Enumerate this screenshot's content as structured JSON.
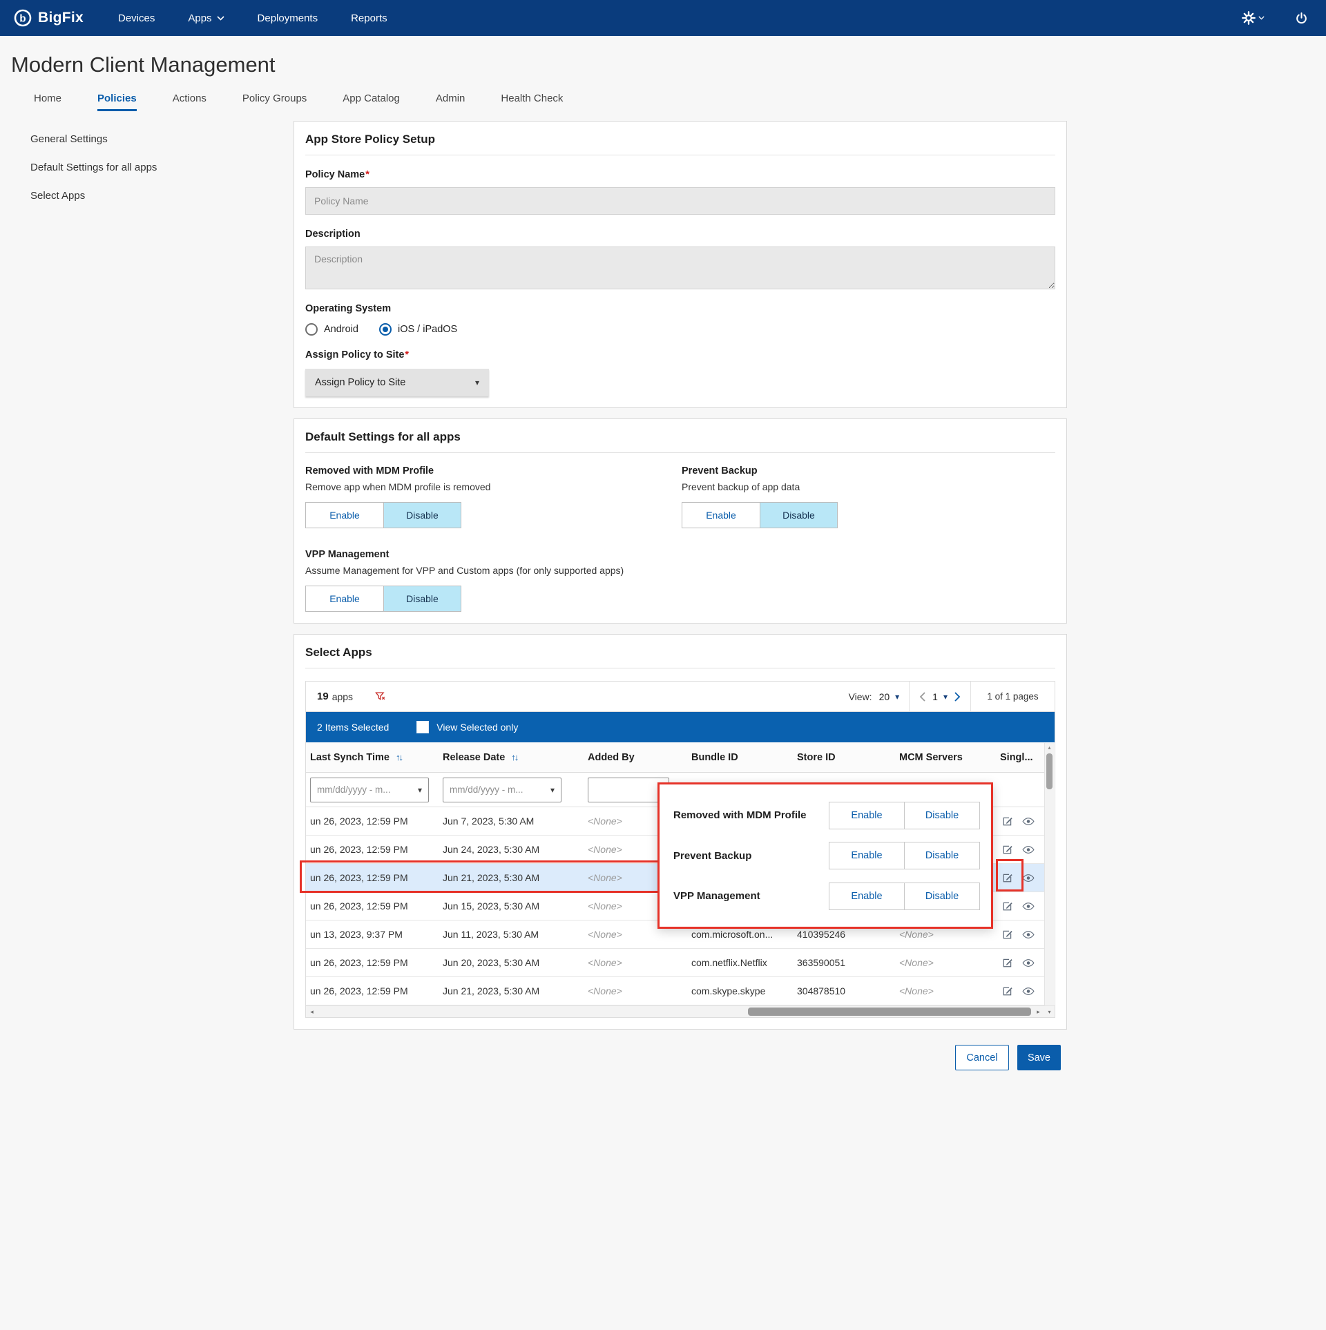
{
  "topnav": {
    "brand": "BigFix",
    "items": [
      {
        "label": "Devices"
      },
      {
        "label": "Apps"
      },
      {
        "label": "Deployments"
      },
      {
        "label": "Reports"
      }
    ]
  },
  "page": {
    "title": "Modern Client Management"
  },
  "tabs": [
    {
      "label": "Home"
    },
    {
      "label": "Policies"
    },
    {
      "label": "Actions"
    },
    {
      "label": "Policy Groups"
    },
    {
      "label": "App Catalog"
    },
    {
      "label": "Admin"
    },
    {
      "label": "Health Check"
    }
  ],
  "sidebar": [
    {
      "label": "General Settings"
    },
    {
      "label": "Default Settings for all apps"
    },
    {
      "label": "Select Apps"
    }
  ],
  "policy_setup": {
    "title": "App Store Policy Setup",
    "policy_name_label": "Policy Name",
    "required_mark": "*",
    "policy_name_placeholder": "Policy Name",
    "description_label": "Description",
    "description_placeholder": "Description",
    "os_label": "Operating System",
    "os_android": "Android",
    "os_ios": "iOS / iPadOS",
    "assign_label": "Assign Policy to Site",
    "assign_value": "Assign Policy to Site"
  },
  "default_settings": {
    "title": "Default Settings for all apps",
    "enable_label": "Enable",
    "disable_label": "Disable",
    "groups": [
      {
        "name": "Removed with MDM Profile",
        "desc": "Remove app when MDM profile is removed"
      },
      {
        "name": "Prevent Backup",
        "desc": "Prevent backup of app data"
      },
      {
        "name": "VPP Management",
        "desc": "Assume Management for VPP and Custom apps (for only supported apps)"
      }
    ]
  },
  "select_apps": {
    "title": "Select Apps",
    "count": "19",
    "count_label": "apps",
    "view_label": "View:",
    "view_value": "20",
    "page_value": "1",
    "pages_text": "1 of 1 pages",
    "selected_text": "2 Items Selected",
    "view_selected_label": "View Selected only",
    "columns": [
      "Last Synch Time",
      "Release Date",
      "Added By",
      "Bundle ID",
      "Store ID",
      "MCM Servers",
      "Singl..."
    ],
    "date_filter_placeholder": "mm/dd/yyyy - m...",
    "rows": [
      {
        "synch": "un 26, 2023, 12:59 PM",
        "release": "Jun 7, 2023, 5:30 AM",
        "added_by": "<None>",
        "bundle_id": "",
        "store_id": "",
        "mcm": ""
      },
      {
        "synch": "un 26, 2023, 12:59 PM",
        "release": "Jun 24, 2023, 5:30 AM",
        "added_by": "<None>",
        "bundle_id": "",
        "store_id": "",
        "mcm": ""
      },
      {
        "synch": "un 26, 2023, 12:59 PM",
        "release": "Jun 21, 2023, 5:30 AM",
        "added_by": "<None>",
        "bundle_id": "",
        "store_id": "",
        "mcm": ""
      },
      {
        "synch": "un 26, 2023, 12:59 PM",
        "release": "Jun 15, 2023, 5:30 AM",
        "added_by": "<None>",
        "bundle_id": "",
        "store_id": "",
        "mcm": ""
      },
      {
        "synch": "un 13, 2023, 9:37 PM",
        "release": "Jun 11, 2023, 5:30 AM",
        "added_by": "<None>",
        "bundle_id": "com.microsoft.on...",
        "store_id": "410395246",
        "mcm": "<None>"
      },
      {
        "synch": "un 26, 2023, 12:59 PM",
        "release": "Jun 20, 2023, 5:30 AM",
        "added_by": "<None>",
        "bundle_id": "com.netflix.Netflix",
        "store_id": "363590051",
        "mcm": "<None>"
      },
      {
        "synch": "un 26, 2023, 12:59 PM",
        "release": "Jun 21, 2023, 5:30 AM",
        "added_by": "<None>",
        "bundle_id": "com.skype.skype",
        "store_id": "304878510",
        "mcm": "<None>"
      }
    ],
    "overlay": {
      "enable_label": "Enable",
      "disable_label": "Disable",
      "items": [
        {
          "name": "Removed with MDM Profile"
        },
        {
          "name": "Prevent Backup"
        },
        {
          "name": "VPP Management"
        }
      ]
    }
  },
  "footer": {
    "cancel": "Cancel",
    "save": "Save"
  },
  "colors": {
    "accent_blue": "#0a5dab",
    "nav_blue": "#0a3c7d",
    "bar_blue": "#0a61af",
    "disable_cyan": "#b9e7f7",
    "annotation_red": "#e63228"
  }
}
